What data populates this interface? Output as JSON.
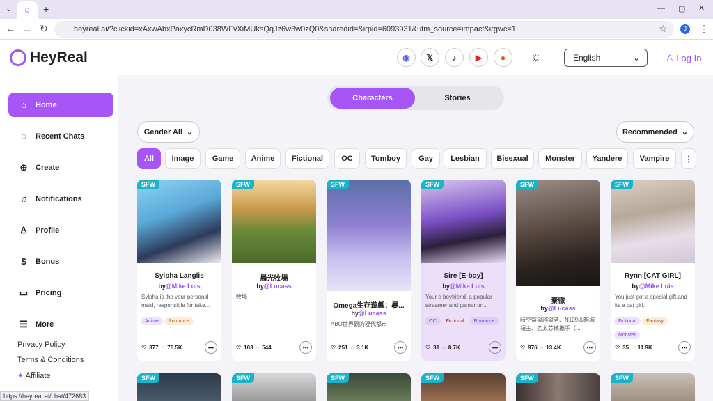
{
  "browser": {
    "url": "heyreal.ai/?clickid=xAxwAbxPaxycRmD038WFvXiMUksQqJz6w3w0zQ0&sharedid=&irpid=6093931&utm_source=impact&irgwc=1",
    "status_url": "https://heyreal.ai/chat/472683"
  },
  "header": {
    "logo": "HeyReal",
    "language": "English",
    "login": "Log In",
    "socials": [
      "discord-icon",
      "x-icon",
      "tiktok-icon",
      "youtube-icon",
      "reddit-icon"
    ]
  },
  "sidebar": {
    "items": [
      {
        "label": "Home",
        "icon": "home-icon"
      },
      {
        "label": "Recent Chats",
        "icon": "chat-icon"
      },
      {
        "label": "Create",
        "icon": "plus-icon"
      },
      {
        "label": "Notifications",
        "icon": "bell-icon"
      },
      {
        "label": "Profile",
        "icon": "user-icon"
      },
      {
        "label": "Bonus",
        "icon": "dollar-icon"
      },
      {
        "label": "Pricing",
        "icon": "card-icon"
      },
      {
        "label": "More",
        "icon": "menu-icon"
      }
    ],
    "links": [
      "Privacy Policy",
      "Terms & Conditions",
      "Affiliate"
    ]
  },
  "tabs": {
    "characters": "Characters",
    "stories": "Stories"
  },
  "filters": {
    "gender": "Gender All",
    "sort": "Recommended",
    "chips": [
      "All",
      "Image",
      "Game",
      "Anime",
      "Fictional",
      "OC",
      "Tomboy",
      "Gay",
      "Lesbian",
      "Bisexual",
      "Monster",
      "Yandere",
      "Vampire"
    ]
  },
  "badge": "SFW",
  "cards": [
    {
      "title": "Sylpha Langlis",
      "by": "by",
      "author": "@Mike Luis",
      "desc": "Sylpha is the your personal maid, responsible for take...",
      "tags": [
        "Anime",
        "Romance"
      ],
      "likes": "377",
      "chats": "76.5K"
    },
    {
      "title": "晨光牧場",
      "by": "by",
      "author": "@Lucass",
      "desc": "牧場",
      "tags": [],
      "likes": "103",
      "chats": "544"
    },
    {
      "title": "Omega生存遊戲：暴...",
      "by": "by",
      "author": "@Lucass",
      "desc": "ABO世界觀的現代都市",
      "tags": [],
      "likes": "251",
      "chats": "3.1K"
    },
    {
      "title": "Sire [E-boy]",
      "by": "by",
      "author": "@Mike Luis",
      "desc": "Your e boyfriend, a popular streamer and gamer on...",
      "tags": [
        "OC",
        "Fictional",
        "Romance"
      ],
      "likes": "31",
      "chats": "8.7K"
    },
    {
      "title": "秦徹",
      "by": "by",
      "author": "@Lucass",
      "desc": "時空監獄越獄者、N109區暗城領主、乙太芯核攜手（...",
      "tags": [],
      "likes": "976",
      "chats": "13.4K"
    },
    {
      "title": "Rynn [CAT GIRL]",
      "by": "by",
      "author": "@Mike Luis",
      "desc": "You just got a special gift and its a cat girl.",
      "tags": [
        "Fictional",
        "Fantasy",
        "Monster"
      ],
      "likes": "35",
      "chats": "11.9K"
    }
  ],
  "colors": {
    "accent": "#a855f7",
    "sfw": "#1ab3c9"
  }
}
